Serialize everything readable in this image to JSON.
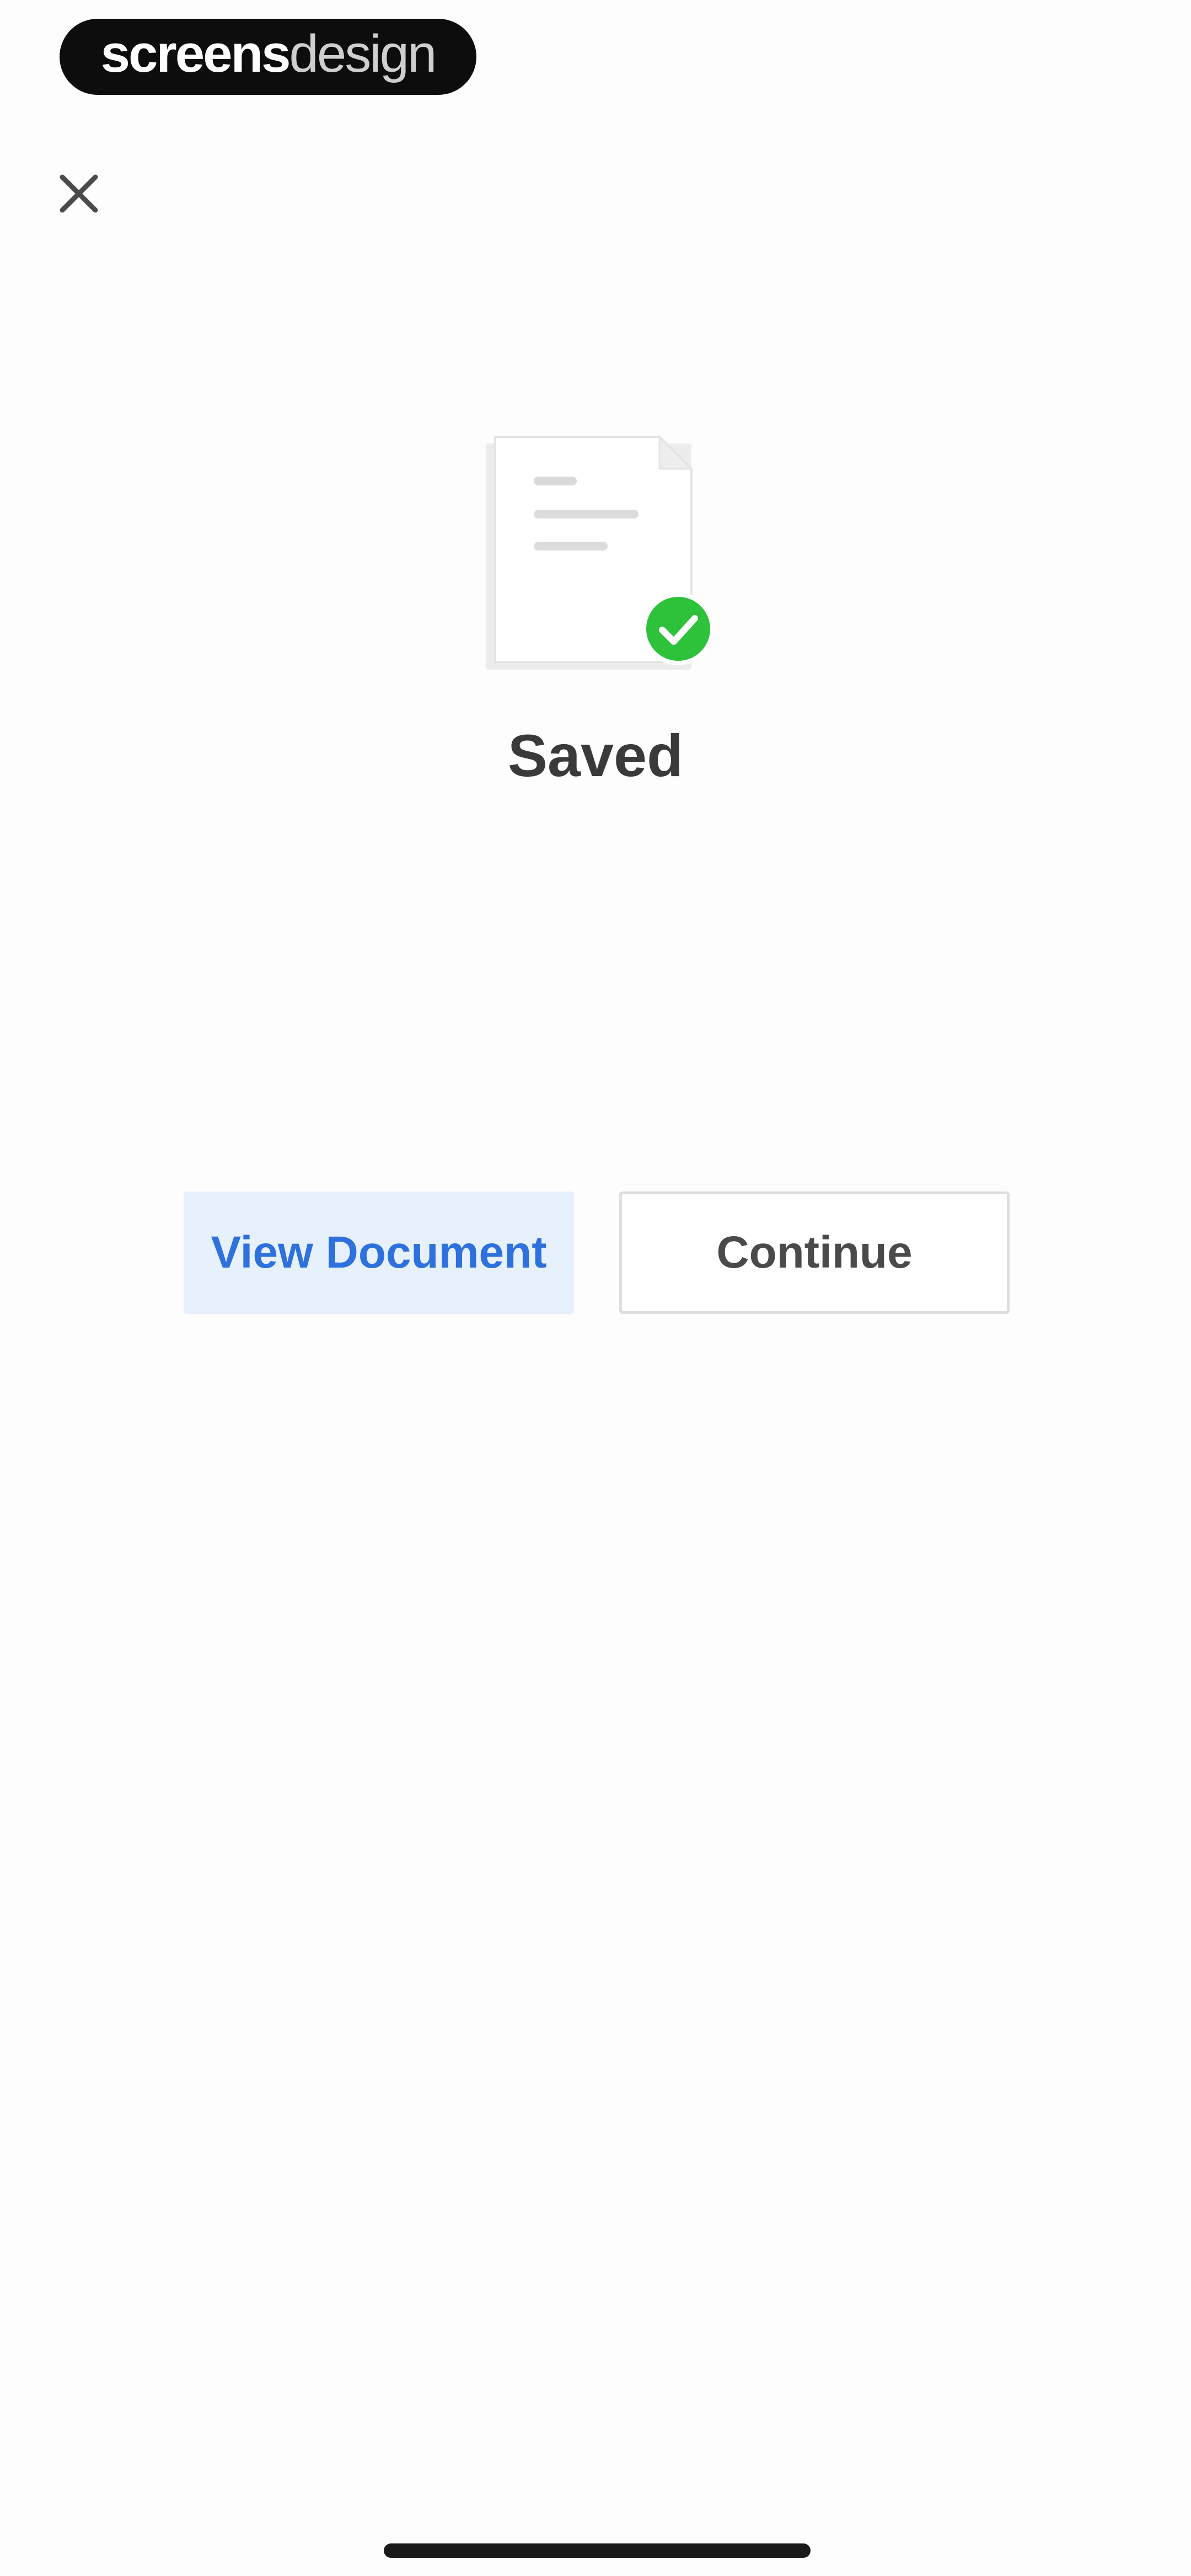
{
  "watermark": {
    "strong": "screens",
    "light": "design"
  },
  "close": {
    "icon": "close-icon"
  },
  "illustration": {
    "icon": "document-saved-icon",
    "check_color": "#2dc23a"
  },
  "status": {
    "title": "Saved"
  },
  "actions": {
    "view_document_label": "View Document",
    "continue_label": "Continue"
  },
  "colors": {
    "accent": "#2e71dc",
    "accent_bg": "#e7f0fd",
    "success": "#2dc23a"
  }
}
